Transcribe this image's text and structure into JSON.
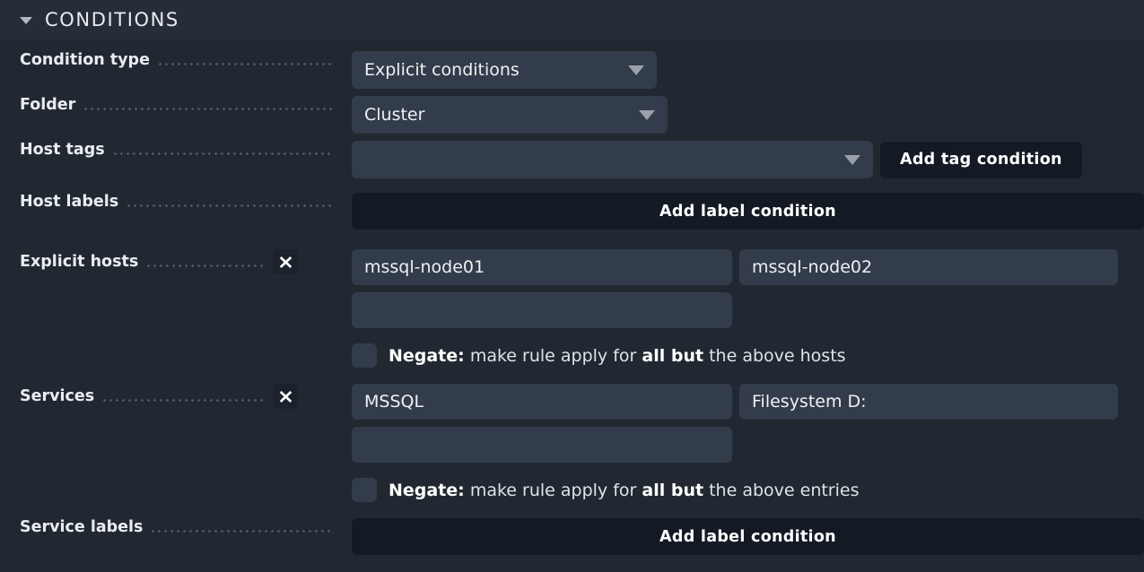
{
  "section": {
    "title": "CONDITIONS",
    "expanded": true,
    "caret_icon": "caret-down-icon"
  },
  "colors": {
    "page_background": "#212831",
    "header_background": "#262d38",
    "field_background": "#333c4a",
    "button_background": "#141a23",
    "text_primary": "#e9ecf0",
    "leader_dots": "#59616d",
    "arrow": "#9aa1ab"
  },
  "rows": {
    "condition_type": {
      "label": "Condition type",
      "select_value": "Explicit conditions",
      "arrow_icon": "chevron-down-icon"
    },
    "folder": {
      "label": "Folder",
      "select_value": "Cluster",
      "arrow_icon": "chevron-down-icon"
    },
    "host_tags": {
      "label": "Host tags",
      "select_value": "",
      "arrow_icon": "chevron-down-icon",
      "button_label": "Add tag condition"
    },
    "host_labels": {
      "label": "Host labels",
      "button_label": "Add label condition"
    },
    "explicit_hosts": {
      "label": "Explicit hosts",
      "delete_icon": "close-x-icon",
      "values": [
        "mssql-node01",
        "mssql-node02",
        "",
        ""
      ],
      "placeholder": "",
      "negate": {
        "checked": false,
        "prefix": "Negate:",
        "middle": " make rule apply for ",
        "emphasis": "all but",
        "suffix": " the above hosts"
      }
    },
    "services": {
      "label": "Services",
      "delete_icon": "close-x-icon",
      "values": [
        "MSSQL",
        "Filesystem D:",
        "",
        ""
      ],
      "placeholder": "",
      "negate": {
        "checked": false,
        "prefix": "Negate:",
        "middle": " make rule apply for ",
        "emphasis": "all but",
        "suffix": " the above entries"
      }
    },
    "service_labels": {
      "label": "Service labels",
      "button_label": "Add label condition"
    }
  }
}
